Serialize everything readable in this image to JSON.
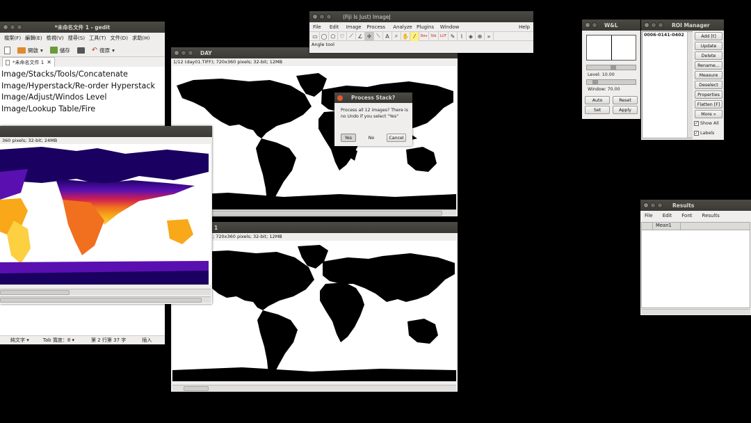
{
  "gedit": {
    "title": "*未命名文件 1 - gedit",
    "menu": [
      "檔案(F)",
      "編輯(E)",
      "檢視(V)",
      "搜尋(S)",
      "工具(T)",
      "文件(D)",
      "求助(H)"
    ],
    "toolbar": {
      "open": "開啟",
      "save": "儲存",
      "undo": "復原"
    },
    "tab_label": "*未命名文件 1",
    "lines": [
      "Image/Stacks/Tools/Concatenate",
      "Image/Hyperstack/Re-order Hyperstack",
      "Image/Adjust/Windos Level",
      "Image/Lookup Table/Fire"
    ],
    "status": {
      "mode": "純文字 ▾",
      "tab_width": "Tab 寬度：8 ▾",
      "position": "第 2 行第 37 字",
      "insert": "插入"
    }
  },
  "imagej": {
    "title": "(Fiji Is Just) ImageJ",
    "menu": [
      "File",
      "Edit",
      "Image",
      "Process",
      "Analyze",
      "Plugins",
      "Window",
      "Help"
    ],
    "tools": [
      "Dev",
      "Stk",
      "LUT"
    ],
    "status": "Angle tool",
    "more": "»"
  },
  "day_window": {
    "title": "DAY",
    "info": "1/12 (day01.TIFF); 720x360 pixels; 32-bit; 12MB"
  },
  "fire_window": {
    "info": "360 pixels; 32-bit; 24MB"
  },
  "night_window": {
    "title_tail": "1",
    "info": "; 720x360 pixels; 32-bit; 12MB"
  },
  "dialog": {
    "title": "Process Stack?",
    "message": "Process all 12 images? There is no Undo if you select \"Yes\"",
    "yes": "Yes",
    "no": "No",
    "cancel": "Cancel"
  },
  "wl": {
    "title": "W&L",
    "level_label": "Level:  10.00",
    "window_label": "Window:  70.00",
    "buttons": [
      "Auto",
      "Reset",
      "Set",
      "Apply"
    ]
  },
  "roi": {
    "title": "ROI Manager",
    "items": [
      "0006-0141-0402"
    ],
    "buttons": [
      "Add [t]",
      "Update",
      "Delete",
      "Rename...",
      "Measure",
      "Deselect",
      "Properties",
      "Flatten [F]",
      "More »"
    ],
    "show_all": "Show All",
    "labels": "Labels"
  },
  "results": {
    "title": "Results",
    "menu": [
      "File",
      "Edit",
      "Font",
      "Results"
    ],
    "column": "Mean1"
  }
}
